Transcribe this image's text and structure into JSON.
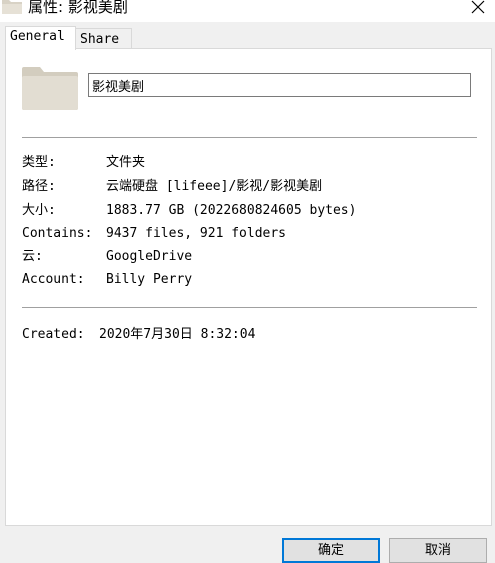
{
  "window": {
    "title": "属性: 影视美剧"
  },
  "tabs": [
    {
      "label": "General",
      "active": true
    },
    {
      "label": "Share",
      "active": false
    }
  ],
  "item": {
    "name": "影视美剧",
    "icon": "folder-icon"
  },
  "properties": [
    {
      "label": "类型:",
      "value": "文件夹"
    },
    {
      "label": "路径:",
      "value": "云端硬盘 [lifeee]/影视/影视美剧"
    },
    {
      "label": "大小:",
      "value": "1883.77 GB (2022680824605 bytes)"
    },
    {
      "label": "Contains:",
      "value": "9437 files, 921 folders"
    },
    {
      "label": "云:",
      "value": "GoogleDrive"
    },
    {
      "label": "Account:",
      "value": "Billy Perry"
    }
  ],
  "created": {
    "label": "Created:",
    "value": "2020年7月30日 8:32:04"
  },
  "buttons": {
    "ok": "确定",
    "cancel": "取消"
  },
  "colors": {
    "folder": "#d8d2c5",
    "accent": "#0078d7"
  }
}
